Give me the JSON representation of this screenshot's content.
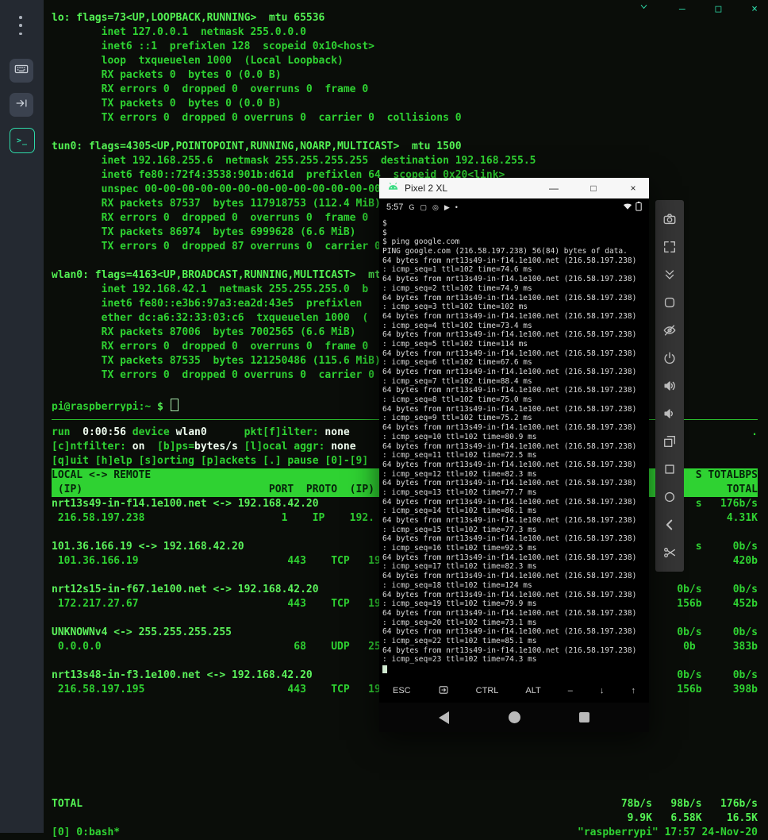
{
  "app": {
    "accent_color": "#2ed9a8",
    "terminal_green": "#2fd232",
    "window_controls": {
      "minimize": "—",
      "maximize": "□",
      "close": "×"
    },
    "sidebar_icons": [
      "kebab-menu-icon",
      "keyboard-icon",
      "send-icon",
      "terminal-icon"
    ],
    "terminal_icon_glyph": ">_"
  },
  "term": {
    "ifconfig_lines": [
      {
        "t": "lo: flags=73<UP,LOOPBACK,RUNNING>  mtu 65536",
        "c": "b"
      },
      {
        "t": "        inet 127.0.0.1  netmask 255.0.0.0",
        "c": ""
      },
      {
        "t": "        inet6 ::1  prefixlen 128  scopeid 0x10<host>",
        "c": ""
      },
      {
        "t": "        loop  txqueuelen 1000  (Local Loopback)",
        "c": ""
      },
      {
        "t": "        RX packets 0  bytes 0 (0.0 B)",
        "c": ""
      },
      {
        "t": "        RX errors 0  dropped 0  overruns 0  frame 0",
        "c": ""
      },
      {
        "t": "        TX packets 0  bytes 0 (0.0 B)",
        "c": ""
      },
      {
        "t": "        TX errors 0  dropped 0 overruns 0  carrier 0  collisions 0",
        "c": ""
      },
      {
        "t": "",
        "c": ""
      },
      {
        "t": "tun0: flags=4305<UP,POINTOPOINT,RUNNING,NOARP,MULTICAST>  mtu 1500",
        "c": "b"
      },
      {
        "t": "        inet 192.168.255.6  netmask 255.255.255.255  destination 192.168.255.5",
        "c": ""
      },
      {
        "t": "        inet6 fe80::72f4:3538:901b:d61d  prefixlen 64  scopeid 0x20<link>",
        "c": ""
      },
      {
        "t": "        unspec 00-00-00-00-00-00-00-00-00-00-00-00-00",
        "c": ""
      },
      {
        "t": "        RX packets 87537  bytes 117918753 (112.4 MiB)",
        "c": ""
      },
      {
        "t": "        RX errors 0  dropped 0  overruns 0  frame 0",
        "c": ""
      },
      {
        "t": "        TX packets 86974  bytes 6999628 (6.6 MiB)",
        "c": ""
      },
      {
        "t": "        TX errors 0  dropped 87 overruns 0  carrier 0",
        "c": ""
      },
      {
        "t": "",
        "c": ""
      },
      {
        "t": "wlan0: flags=4163<UP,BROADCAST,RUNNING,MULTICAST>  mtu",
        "c": "b"
      },
      {
        "t": "        inet 192.168.42.1  netmask 255.255.255.0  b",
        "c": ""
      },
      {
        "t": "        inet6 fe80::e3b6:97a3:ea2d:43e5  prefixlen ",
        "c": ""
      },
      {
        "t": "        ether dc:a6:32:33:03:c6  txqueuelen 1000  (",
        "c": ""
      },
      {
        "t": "        RX packets 87006  bytes 7002565 (6.6 MiB)",
        "c": ""
      },
      {
        "t": "        RX errors 0  dropped 0  overruns 0  frame 0",
        "c": ""
      },
      {
        "t": "        TX packets 87535  bytes 121250486 (115.6 MiB)",
        "c": ""
      },
      {
        "t": "        TX errors 0  dropped 0 overruns 0  carrier 0",
        "c": ""
      },
      {
        "t": "",
        "c": ""
      }
    ],
    "prompt_user": "pi@raspberrypi:~ ",
    "prompt_symbol": "$",
    "jnettop": {
      "info1": [
        {
          "t": "run  ",
          "c": ""
        },
        {
          "t": "0:00:56",
          "c": "w"
        },
        {
          "t": " device ",
          "c": ""
        },
        {
          "t": "wlan0",
          "c": "w"
        },
        {
          "t": "      pkt[f]ilter: ",
          "c": ""
        },
        {
          "t": "none",
          "c": "w"
        }
      ],
      "info1_right": ".",
      "info2": [
        {
          "t": "[c]ntfilter: ",
          "c": ""
        },
        {
          "t": "on",
          "c": "w"
        },
        {
          "t": "  [b]ps=",
          "c": ""
        },
        {
          "t": "bytes/s",
          "c": "w"
        },
        {
          "t": " [l]ocal aggr: ",
          "c": ""
        },
        {
          "t": "none",
          "c": "w"
        }
      ],
      "info3": "[q]uit [h]elp [s]orting [p]ackets [.] pause [0]-[9]",
      "band1_left": "LOCAL <-> REMOTE",
      "band1_right": "S TOTALBPS",
      "band2_left": " (IP)                              PORT  PROTO  (IP)",
      "band2_right": "TOTAL",
      "flows": [
        {
          "h": "nrt13s49-in-f14.1e100.net <-> 192.168.42.20",
          "hr": "s   176b/s",
          "d": " 216.58.197.238                      1    IP    192.",
          "dr": "4.31K"
        },
        {
          "h": "101.36.166.19 <-> 192.168.42.20",
          "hr": "s     0b/s",
          "d": " 101.36.166.19                        443    TCP   192.",
          "dr": "420b"
        },
        {
          "h": "nrt12s15-in-f67.1e100.net <-> 192.168.42.20",
          "hr": "0b/s     0b/s",
          "d": " 172.217.27.67                        443    TCP   192.",
          "dr": "156b     452b"
        },
        {
          "h": "UNKNOWNv4 <-> 255.255.255.255",
          "hr": "0b/s     0b/s",
          "d": " 0.0.0.0                               68    UDP   255.",
          "dr": "0b      383b"
        },
        {
          "h": "nrt13s48-in-f3.1e100.net <-> 192.168.42.20",
          "hr": "0b/s     0b/s",
          "d": " 216.58.197.195                       443    TCP   192.1",
          "dr": "156b     398b"
        }
      ],
      "total_label": "TOTAL",
      "total_r1": "78b/s   98b/s   176b/s",
      "total_r2": "9.9K   6.58K    16.5K"
    },
    "tmux_left": "[0] 0:bash*",
    "tmux_right": "\"raspberrypi\" 17:57 24-Nov-20"
  },
  "phone": {
    "title": "Pixel 2 XL",
    "controls": {
      "minimize": "—",
      "maximize": "□",
      "close": "×"
    },
    "status": {
      "time": "5:57",
      "notification_icons": [
        "G",
        "▢",
        "◎",
        "▶",
        "•"
      ],
      "right_icons": [
        "wifi-icon",
        "battery-icon"
      ]
    },
    "lines": [
      "$",
      "$",
      "$ ping google.com",
      "PING google.com (216.58.197.238) 56(84) bytes of data.",
      "64 bytes from nrt13s49-in-f14.1e100.net (216.58.197.238)",
      ": icmp_seq=1 ttl=102 time=74.6 ms",
      "64 bytes from nrt13s49-in-f14.1e100.net (216.58.197.238)",
      ": icmp_seq=2 ttl=102 time=74.9 ms",
      "64 bytes from nrt13s49-in-f14.1e100.net (216.58.197.238)",
      ": icmp_seq=3 ttl=102 time=102 ms",
      "64 bytes from nrt13s49-in-f14.1e100.net (216.58.197.238)",
      ": icmp_seq=4 ttl=102 time=73.4 ms",
      "64 bytes from nrt13s49-in-f14.1e100.net (216.58.197.238)",
      ": icmp_seq=5 ttl=102 time=114 ms",
      "64 bytes from nrt13s49-in-f14.1e100.net (216.58.197.238)",
      ": icmp_seq=6 ttl=102 time=67.6 ms",
      "64 bytes from nrt13s49-in-f14.1e100.net (216.58.197.238)",
      ": icmp_seq=7 ttl=102 time=88.4 ms",
      "64 bytes from nrt13s49-in-f14.1e100.net (216.58.197.238)",
      ": icmp_seq=8 ttl=102 time=75.0 ms",
      "64 bytes from nrt13s49-in-f14.1e100.net (216.58.197.238)",
      ": icmp_seq=9 ttl=102 time=75.2 ms",
      "64 bytes from nrt13s49-in-f14.1e100.net (216.58.197.238)",
      ": icmp_seq=10 ttl=102 time=80.9 ms",
      "64 bytes from nrt13s49-in-f14.1e100.net (216.58.197.238)",
      ": icmp_seq=11 ttl=102 time=72.5 ms",
      "64 bytes from nrt13s49-in-f14.1e100.net (216.58.197.238)",
      ": icmp_seq=12 ttl=102 time=82.3 ms",
      "64 bytes from nrt13s49-in-f14.1e100.net (216.58.197.238)",
      ": icmp_seq=13 ttl=102 time=77.7 ms",
      "64 bytes from nrt13s49-in-f14.1e100.net (216.58.197.238)",
      ": icmp_seq=14 ttl=102 time=86.1 ms",
      "64 bytes from nrt13s49-in-f14.1e100.net (216.58.197.238)",
      ": icmp_seq=15 ttl=102 time=77.3 ms",
      "64 bytes from nrt13s49-in-f14.1e100.net (216.58.197.238)",
      ": icmp_seq=16 ttl=102 time=92.5 ms",
      "64 bytes from nrt13s49-in-f14.1e100.net (216.58.197.238)",
      ": icmp_seq=17 ttl=102 time=82.3 ms",
      "64 bytes from nrt13s49-in-f14.1e100.net (216.58.197.238)",
      ": icmp_seq=18 ttl=102 time=124 ms",
      "64 bytes from nrt13s49-in-f14.1e100.net (216.58.197.238)",
      ": icmp_seq=19 ttl=102 time=79.9 ms",
      "64 bytes from nrt13s49-in-f14.1e100.net (216.58.197.238)",
      ": icmp_seq=20 ttl=102 time=73.1 ms",
      "64 bytes from nrt13s49-in-f14.1e100.net (216.58.197.238)",
      ": icmp_seq=22 ttl=102 time=85.1 ms",
      "64 bytes from nrt13s49-in-f14.1e100.net (216.58.197.238)",
      ": icmp_seq=23 ttl=102 time=74.3 ms"
    ],
    "extra_keys": {
      "k1": "ESC",
      "k2_icon": "tab-key-icon",
      "k3": "CTRL",
      "k4": "ALT",
      "k5": "–",
      "k6": "↓",
      "k7": "↑"
    },
    "nav_icons": [
      "back-icon",
      "home-icon",
      "recents-icon"
    ]
  },
  "toolbar": {
    "icons": [
      "camera-icon",
      "fullscreen-icon",
      "double-chevron-down-icon",
      "rounded-square-icon",
      "eye-off-icon",
      "power-icon",
      "volume-up-icon",
      "volume-down-icon",
      "overlapping-windows-icon",
      "recents-square-icon",
      "home-circle-icon",
      "back-chevron-icon",
      "scissors-icon"
    ]
  }
}
